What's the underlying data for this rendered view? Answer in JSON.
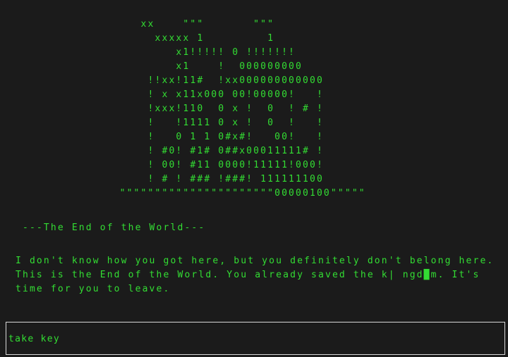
{
  "ascii_art": [
    "                    xx    \"\"\"       \"\"\"",
    "                      xxxxx 1         1",
    "                         x1!!!!! 0 !!!!!!!",
    "                         x1    !  000000000",
    "                     !!xx!11#  !xx000000000000",
    "                     ! x x11x000 00!00000!   !",
    "                     !xxx!110  0 x !  0  ! # !",
    "                     !   !1111 0 x !  0  !   !",
    "                     !   0 1 1 0#x#!   00!   !",
    "                     ! #0! #1# 0##x00011111# !",
    "                     ! 00! #11 0000!11111!000!",
    "                     ! # ! ### !###! 111111100",
    "                 \"\"\"\"\"\"\"\"\"\"\"\"\"\"\"\"\"\"\"\"\"\"00000100\"\"\"\"\""
  ],
  "heading": " ---The End of the World---",
  "narration": [
    "I don't know how you got here, but you definitely don't belong here.",
    "This is the End of the World. You already saved the k| ngd█m. It's",
    "time for you to leave."
  ],
  "command": {
    "value": "take key"
  }
}
